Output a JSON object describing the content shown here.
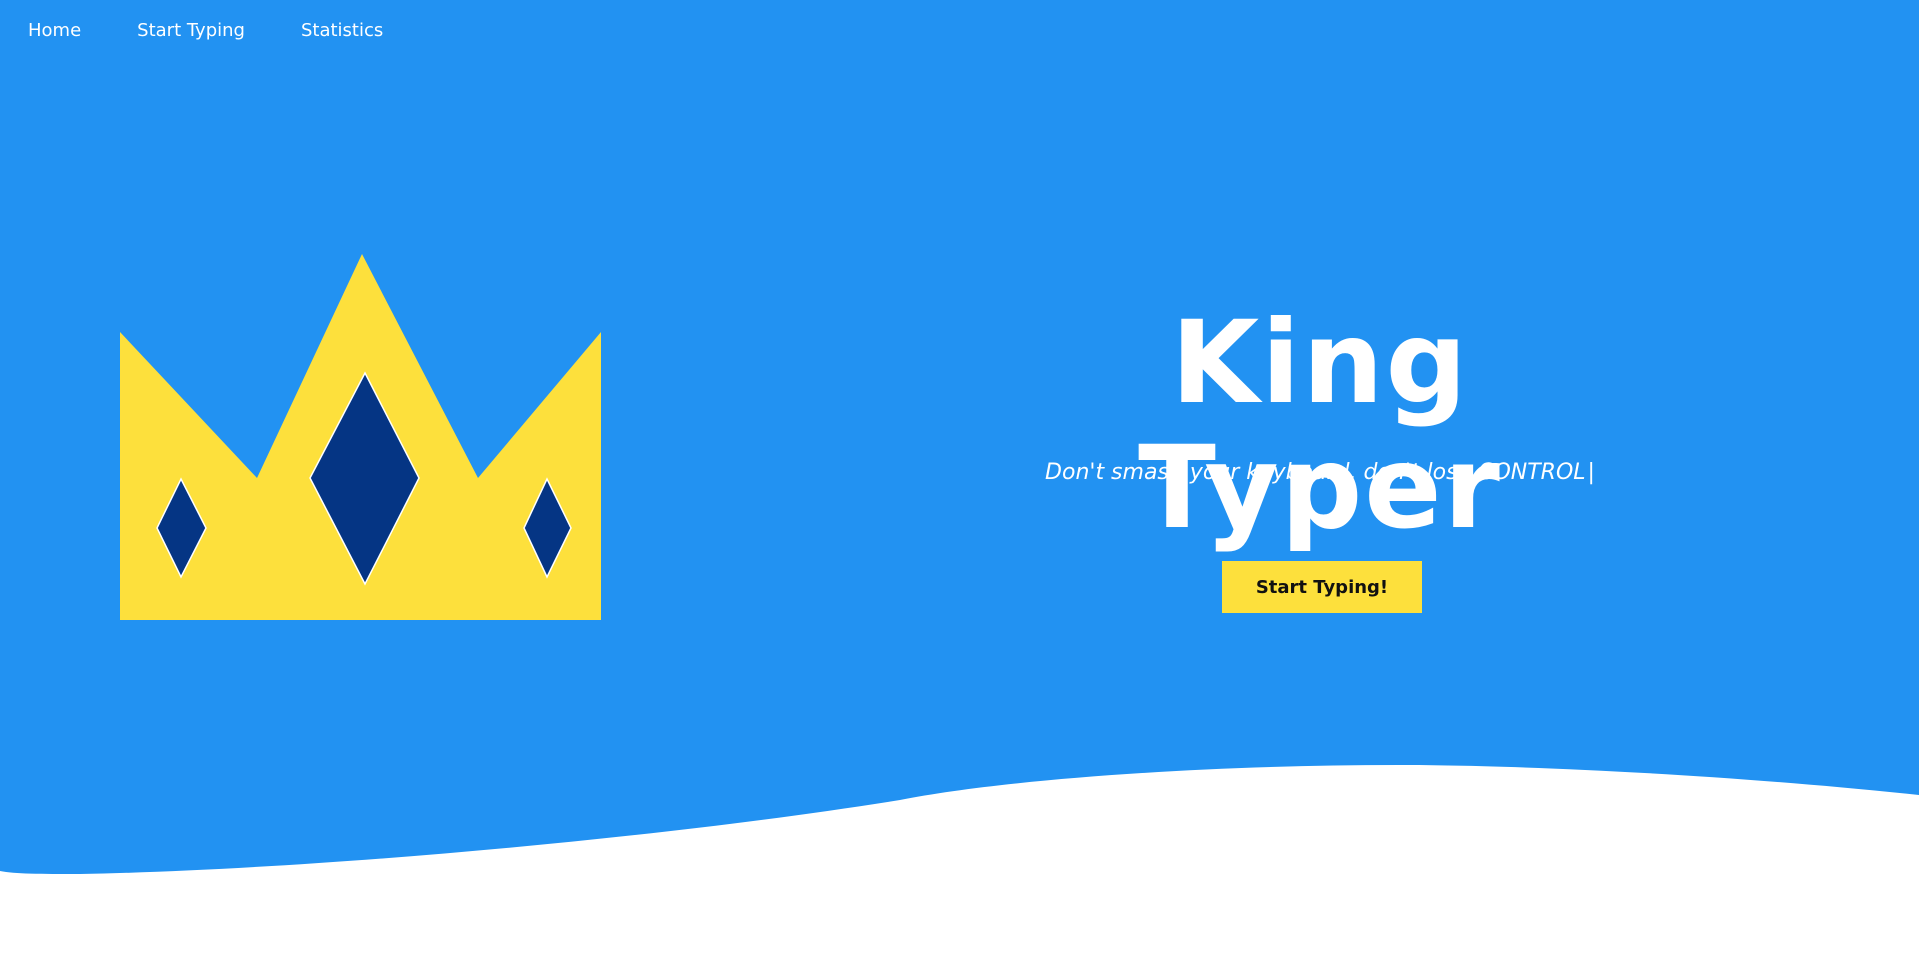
{
  "nav": {
    "items": [
      {
        "label": "Home"
      },
      {
        "label": "Start Typing"
      },
      {
        "label": "Statistics"
      }
    ]
  },
  "hero": {
    "title": "King Typer",
    "tagline": "Don't smash your keyboard, don't lose CONTROL",
    "cursor": "|",
    "cta_label": "Start Typing!"
  },
  "next_section": {
    "heading": ""
  },
  "colors": {
    "hero_bg": "#2292f2",
    "crown_gold": "#fde03c",
    "crown_gem": "#053584",
    "cta_bg": "#fde03c",
    "page_bg": "#ffffff"
  },
  "icons": {
    "logo": "crown-icon"
  }
}
